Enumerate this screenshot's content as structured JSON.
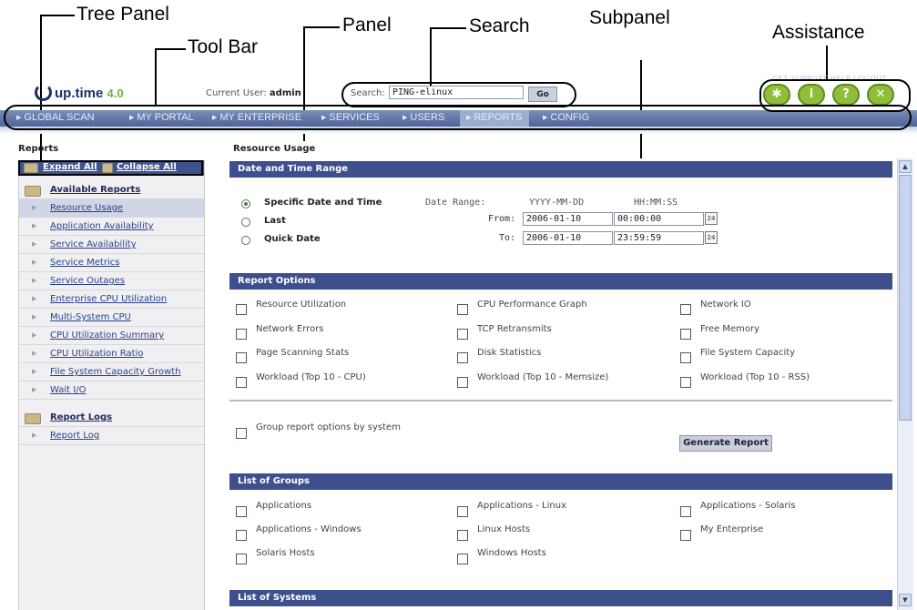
{
  "callouts": {
    "tree_panel": "Tree Panel",
    "tool_bar": "Tool Bar",
    "panel": "Panel",
    "search": "Search",
    "subpanel": "Subpanel",
    "assistance": "Assistance"
  },
  "header": {
    "logo": "up.time",
    "logo_version": "4.0",
    "current_user_label": "Current User:",
    "current_user": "admin",
    "search_label": "Search:",
    "search_value": "PING-elinux",
    "go_label": "Go",
    "top_links": "GET SUPPORT   HELP   LOGOUT"
  },
  "assistance_buttons": [
    {
      "icon": "asterisk-icon",
      "glyph": "✱"
    },
    {
      "icon": "info-icon",
      "glyph": "i"
    },
    {
      "icon": "help-icon",
      "glyph": "?"
    },
    {
      "icon": "close-icon",
      "glyph": "✕"
    }
  ],
  "toolbar": {
    "items": [
      "GLOBAL SCAN",
      "MY PORTAL",
      "MY ENTERPRISE",
      "SERVICES",
      "USERS",
      "REPORTS",
      "CONFIG"
    ],
    "active": "REPORTS"
  },
  "left": {
    "title": "Reports",
    "expand_all": "Expand All",
    "collapse_all": "Collapse All",
    "group1": "Available Reports",
    "items": [
      "Resource Usage",
      "Application Availability",
      "Service Availability",
      "Service Metrics",
      "Service Outages",
      "Enterprise CPU Utilization",
      "Multi-System CPU",
      "CPU Utilization Summary",
      "CPU Utilization Ratio",
      "File System Capacity Growth",
      "Wait I/O"
    ],
    "group2": "Report Logs",
    "log_items": [
      "Report Log"
    ]
  },
  "main": {
    "title": "Resource Usage",
    "date_header": "Date and Time Range",
    "radio_specific": "Specific Date and Time",
    "radio_last": "Last",
    "radio_quick": "Quick Date",
    "date_range_label": "Date Range:",
    "date_format": "YYYY-MM-DD",
    "time_format": "HH:MM:SS",
    "from_label": "From:",
    "to_label": "To:",
    "from_date": "2006-01-10",
    "from_time": "00:00:00",
    "to_date": "2006-01-10",
    "to_time": "23:59:59",
    "calendar_glyph": "24",
    "options_header": "Report Options",
    "options": [
      [
        "Resource Utilization",
        "CPU Performance Graph",
        "Network IO"
      ],
      [
        "Network Errors",
        "TCP Retransmits",
        "Free Memory"
      ],
      [
        "Page Scanning Stats",
        "Disk Statistics",
        "File System Capacity"
      ],
      [
        "Workload (Top 10 - CPU)",
        "Workload (Top 10 - Memsize)",
        "Workload (Top 10 - RSS)"
      ]
    ],
    "group_by": "Group report options by system",
    "generate": "Generate Report",
    "groups_header": "List of Groups",
    "groups": [
      [
        "Applications",
        "Applications - Linux",
        "Applications - Solaris"
      ],
      [
        "Applications - Windows",
        "Linux Hosts",
        "My Enterprise"
      ],
      [
        "Solaris Hosts",
        "Windows Hosts",
        ""
      ]
    ],
    "systems_header": "List of Systems"
  },
  "colors": {
    "toolbar": "#4e6398",
    "subpanel_header": "#3d4f8c",
    "assist_green": "#8fbf3a"
  }
}
